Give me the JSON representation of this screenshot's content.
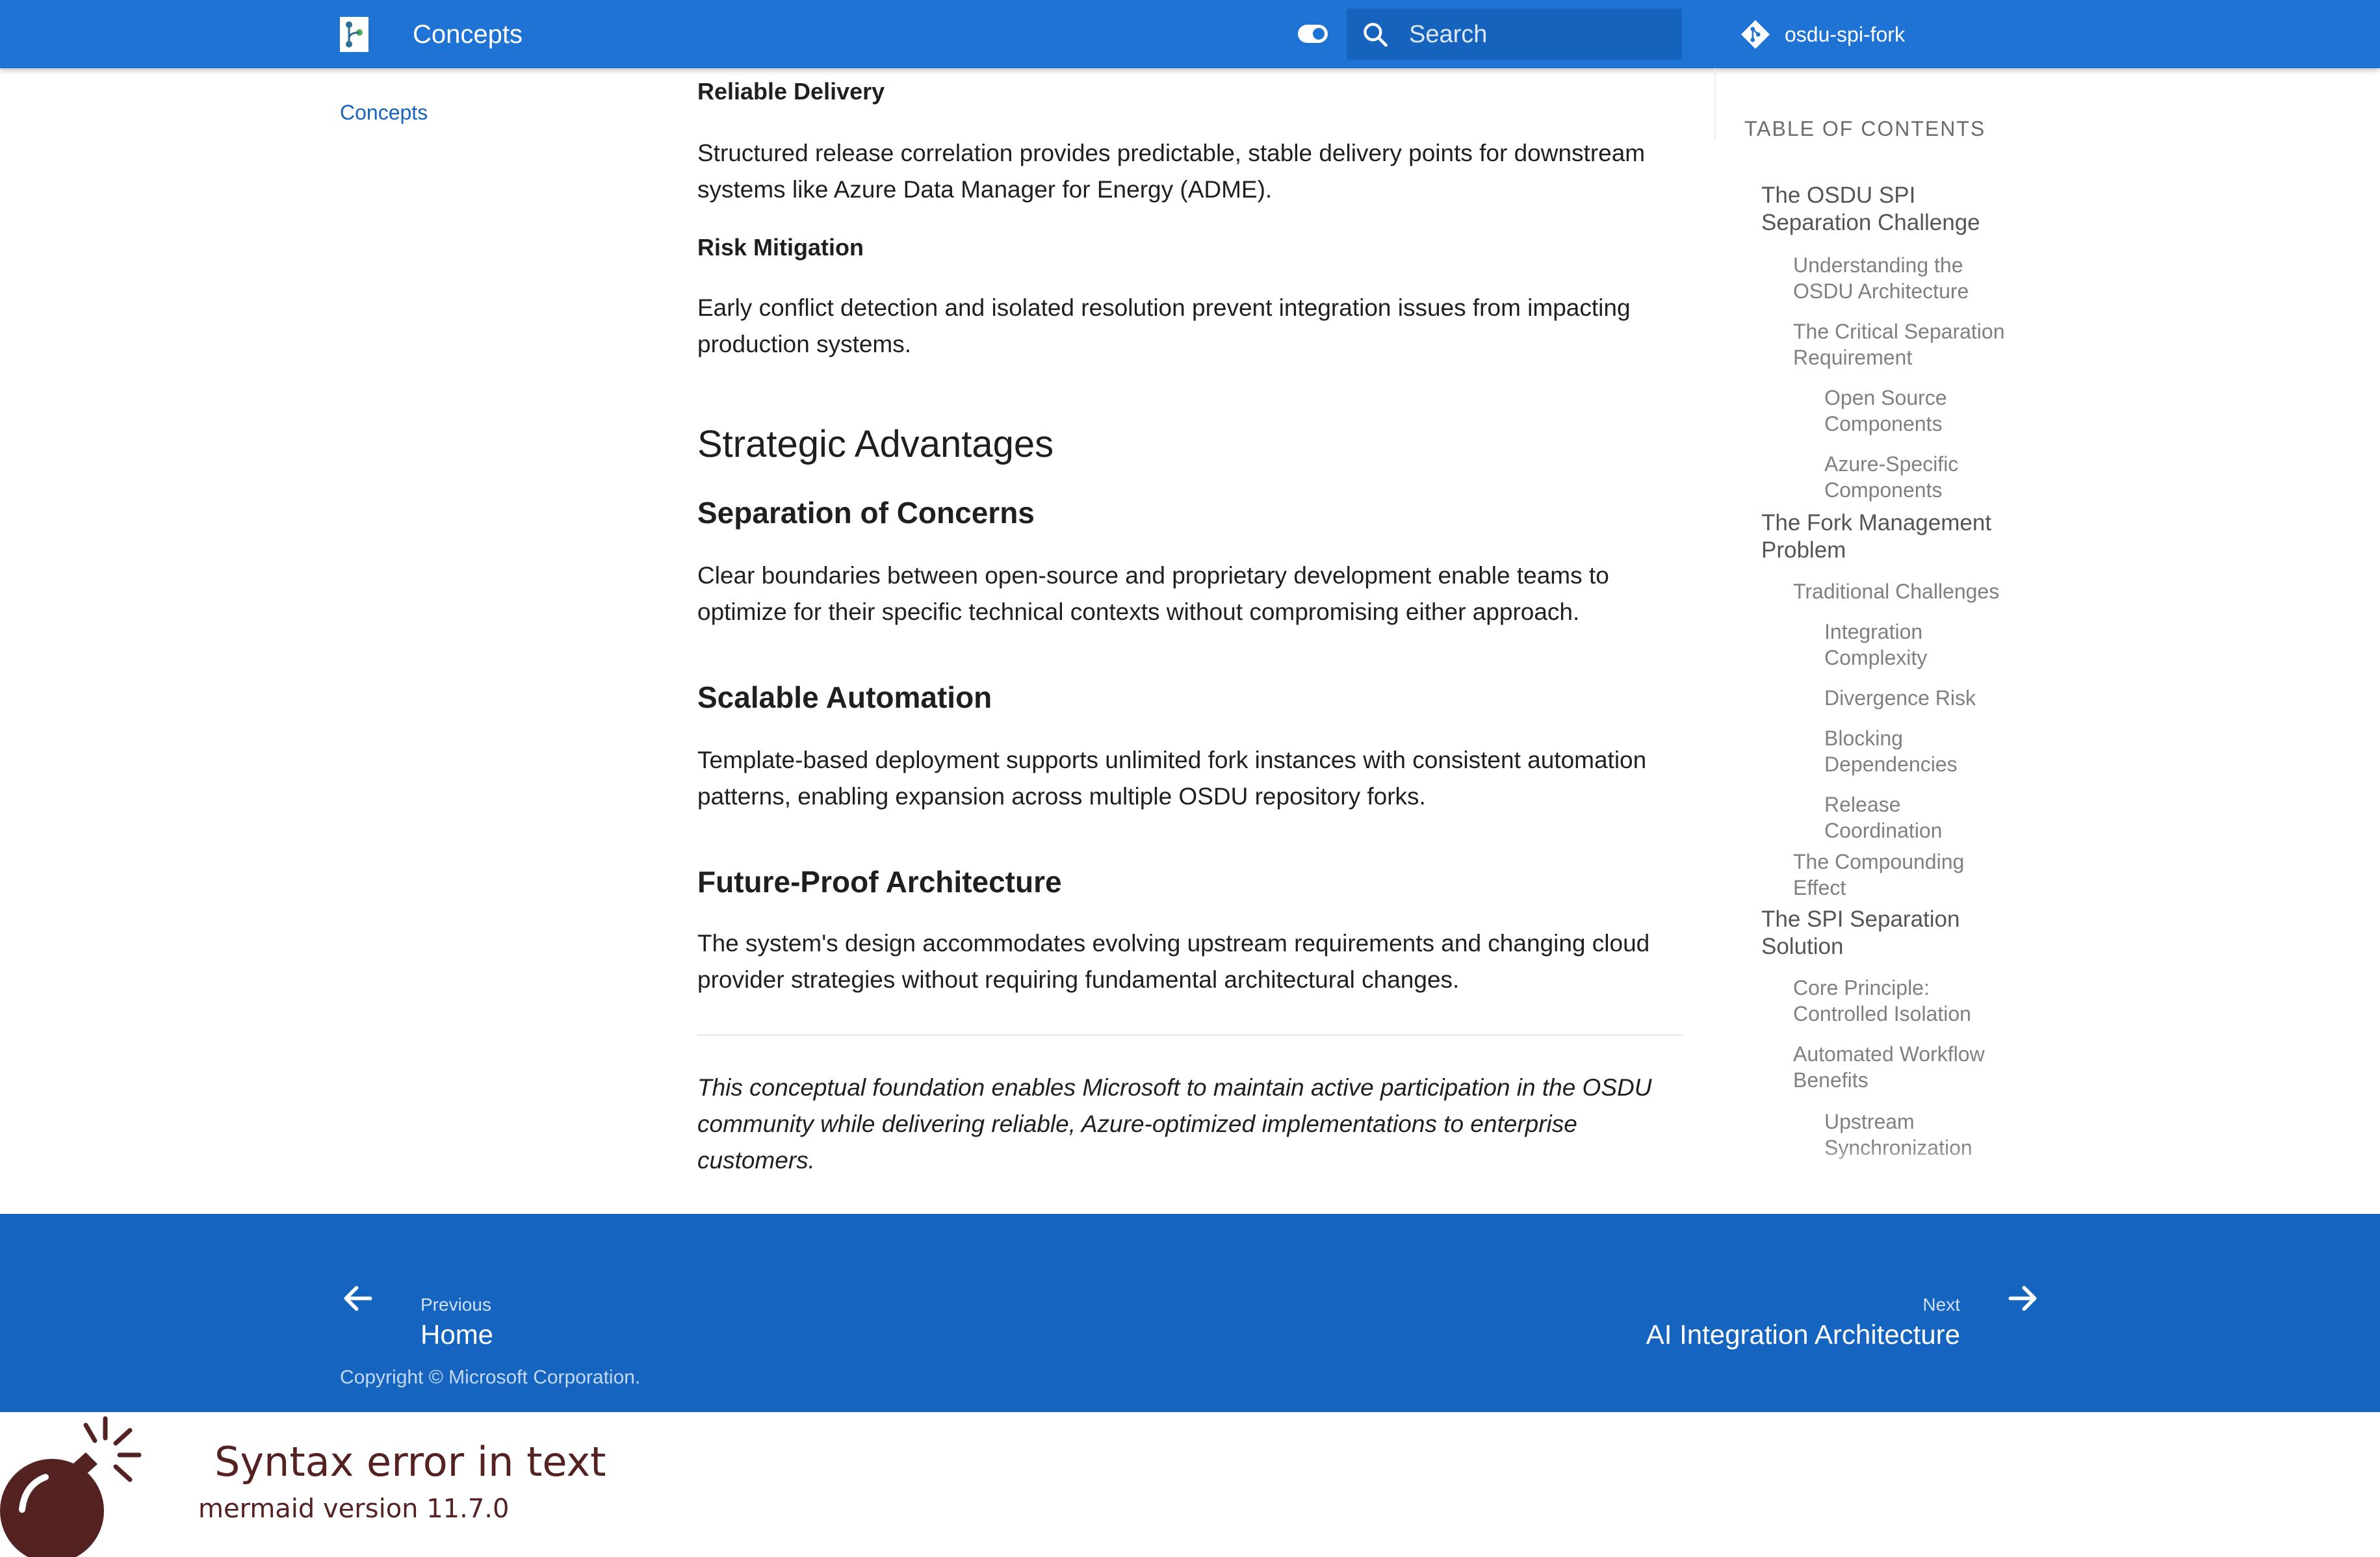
{
  "header": {
    "site_title": "Concepts",
    "search_placeholder": "Search",
    "repo_name": "osdu-spi-fork",
    "colors": {
      "primary": "#1e73d4",
      "search_bg": "#1663bd"
    },
    "icons": [
      "logo-icon",
      "theme-toggle-icon",
      "search-icon",
      "git-icon"
    ]
  },
  "left_nav": {
    "items": [
      {
        "label": "Concepts"
      }
    ]
  },
  "content": {
    "reliable_delivery_heading": "Reliable Delivery",
    "reliable_delivery_text_1": "Structured release correlation provides predictable, stable delivery points for downstream",
    "reliable_delivery_text_2": "systems like Azure Data Manager for Energy (ADME).",
    "risk_heading": "Risk Mitigation",
    "risk_text_1": "Early conflict detection and isolated resolution prevent integration issues from impacting",
    "risk_text_2": "production systems.",
    "strategic_heading": "Strategic Advantages",
    "separation_heading": "Separation of Concerns",
    "separation_text_1": "Clear boundaries between open-source and proprietary development enable teams to",
    "separation_text_2": "optimize for their specific technical contexts without compromising either approach.",
    "scalable_heading": "Scalable Automation",
    "scalable_text_1": "Template-based deployment supports unlimited fork instances with consistent automation",
    "scalable_text_2": "patterns, enabling expansion across multiple OSDU repository forks.",
    "future_heading": "Future-Proof Architecture",
    "future_text_1": "The system's design accommodates evolving upstream requirements and changing cloud",
    "future_text_2": "provider strategies without requiring fundamental architectural changes.",
    "closing_1": "This conceptual foundation enables Microsoft to maintain active participation in the OSDU",
    "closing_2": "community while delivering reliable, Azure-optimized implementations to enterprise",
    "closing_3": "customers."
  },
  "toc": {
    "title": "TABLE OF CONTENTS",
    "items": [
      {
        "level": 1,
        "lines": [
          "The OSDU SPI",
          "Separation Challenge"
        ]
      },
      {
        "level": 2,
        "lines": [
          "Understanding the",
          "OSDU Architecture"
        ]
      },
      {
        "level": 2,
        "lines": [
          "The Critical Separation",
          "Requirement"
        ]
      },
      {
        "level": 3,
        "lines": [
          "Open Source",
          "Components"
        ]
      },
      {
        "level": 3,
        "lines": [
          "Azure-Specific",
          "Components"
        ]
      },
      {
        "level": 1,
        "lines": [
          "The Fork Management",
          "Problem"
        ]
      },
      {
        "level": 2,
        "lines": [
          "Traditional Challenges"
        ]
      },
      {
        "level": 3,
        "lines": [
          "Integration",
          "Complexity"
        ]
      },
      {
        "level": 3,
        "lines": [
          "Divergence Risk"
        ]
      },
      {
        "level": 3,
        "lines": [
          "Blocking",
          "Dependencies"
        ]
      },
      {
        "level": 3,
        "lines": [
          "Release",
          "Coordination"
        ]
      },
      {
        "level": 2,
        "lines": [
          "The Compounding",
          "Effect"
        ]
      },
      {
        "level": 1,
        "lines": [
          "The SPI Separation",
          "Solution"
        ]
      },
      {
        "level": 2,
        "lines": [
          "Core Principle:",
          "Controlled Isolation"
        ]
      },
      {
        "level": 2,
        "lines": [
          "Automated Workflow",
          "Benefits"
        ]
      },
      {
        "level": 3,
        "lines": [
          "Upstream",
          "Synchronization"
        ]
      }
    ]
  },
  "footer": {
    "previous_caption": "Previous",
    "previous_title": "Home",
    "next_caption": "Next",
    "next_title": "AI Integration Architecture",
    "copyright": "Copyright © Microsoft Corporation.",
    "background": "#1565c0"
  },
  "mermaid_error": {
    "title": "Syntax error in text",
    "version": "mermaid version 11.7.0",
    "color": "#552222"
  }
}
